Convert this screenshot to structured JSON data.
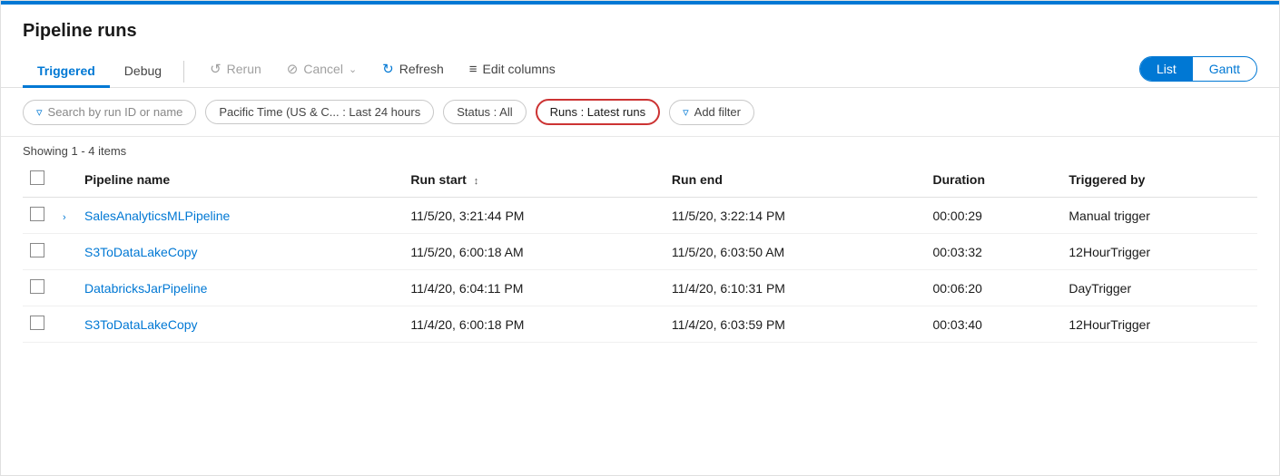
{
  "page": {
    "title": "Pipeline runs",
    "top_bar_color": "#0078d4"
  },
  "toolbar": {
    "tabs": [
      {
        "label": "Triggered",
        "active": true
      },
      {
        "label": "Debug",
        "active": false
      }
    ],
    "actions": [
      {
        "id": "rerun",
        "label": "Rerun",
        "icon": "↺",
        "disabled": true
      },
      {
        "id": "cancel",
        "label": "Cancel",
        "icon": "⊘",
        "disabled": true,
        "has_dropdown": true
      },
      {
        "id": "refresh",
        "label": "Refresh",
        "icon": "↻",
        "disabled": false
      }
    ],
    "edit_columns_label": "Edit columns",
    "view_options": [
      "List",
      "Gantt"
    ],
    "active_view": "List"
  },
  "filters": {
    "search_placeholder": "Search by run ID or name",
    "time_filter": "Pacific Time (US & C...  :  Last 24 hours",
    "status_filter": "Status : All",
    "runs_filter": "Runs : Latest runs",
    "add_filter_label": "Add filter"
  },
  "table": {
    "showing_text": "Showing 1 - 4 items",
    "columns": [
      {
        "id": "pipeline_name",
        "label": "Pipeline name"
      },
      {
        "id": "run_start",
        "label": "Run start",
        "sortable": true
      },
      {
        "id": "run_end",
        "label": "Run end"
      },
      {
        "id": "duration",
        "label": "Duration"
      },
      {
        "id": "triggered_by",
        "label": "Triggered by"
      }
    ],
    "rows": [
      {
        "id": 1,
        "pipeline_name": "SalesAnalyticsMLPipeline",
        "has_expand": true,
        "run_start": "11/5/20, 3:21:44 PM",
        "run_end": "11/5/20, 3:22:14 PM",
        "duration": "00:00:29",
        "triggered_by": "Manual trigger"
      },
      {
        "id": 2,
        "pipeline_name": "S3ToDataLakeCopy",
        "has_expand": false,
        "run_start": "11/5/20, 6:00:18 AM",
        "run_end": "11/5/20, 6:03:50 AM",
        "duration": "00:03:32",
        "triggered_by": "12HourTrigger"
      },
      {
        "id": 3,
        "pipeline_name": "DatabricksJarPipeline",
        "has_expand": false,
        "run_start": "11/4/20, 6:04:11 PM",
        "run_end": "11/4/20, 6:10:31 PM",
        "duration": "00:06:20",
        "triggered_by": "DayTrigger"
      },
      {
        "id": 4,
        "pipeline_name": "S3ToDataLakeCopy",
        "has_expand": false,
        "run_start": "11/4/20, 6:00:18 PM",
        "run_end": "11/4/20, 6:03:59 PM",
        "duration": "00:03:40",
        "triggered_by": "12HourTrigger"
      }
    ]
  }
}
